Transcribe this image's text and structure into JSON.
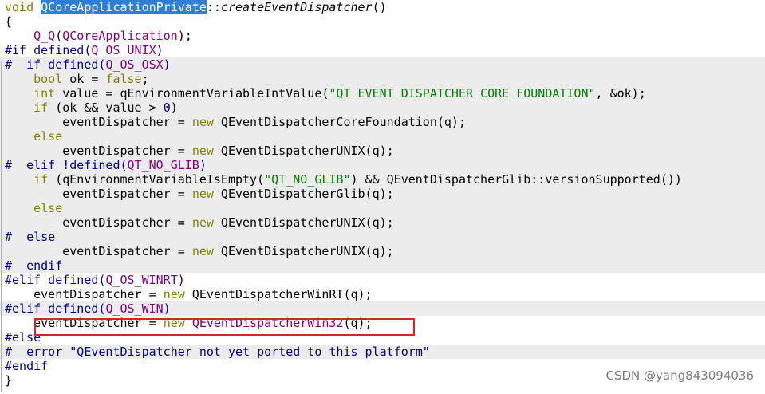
{
  "code_lines": [
    [
      {
        "t": "void",
        "c": "kw"
      },
      {
        "t": " "
      },
      {
        "t": "QCoreApplicationPrivate",
        "c": "sel"
      },
      {
        "t": "::"
      },
      {
        "t": "createEventDispatcher",
        "c": "fn"
      },
      {
        "t": "()"
      }
    ],
    [
      {
        "t": "{"
      }
    ],
    [
      {
        "t": "    "
      },
      {
        "t": "Q_Q",
        "c": "macro"
      },
      {
        "t": "("
      },
      {
        "t": "QCoreApplication",
        "c": "macro"
      },
      {
        "t": ");"
      }
    ],
    [
      {
        "t": "#if defined(",
        "c": "pp"
      },
      {
        "t": "Q_OS_UNIX",
        "c": "macro"
      },
      {
        "t": ")",
        "c": "pp"
      }
    ],
    [
      {
        "t": "#  if defined(",
        "c": "pp"
      },
      {
        "t": "Q_OS_OSX",
        "c": "macro"
      },
      {
        "t": ")",
        "c": "pp"
      }
    ],
    [
      {
        "t": "    "
      },
      {
        "t": "bool",
        "c": "kw"
      },
      {
        "t": " ok = "
      },
      {
        "t": "false",
        "c": "kw"
      },
      {
        "t": ";"
      }
    ],
    [
      {
        "t": "    "
      },
      {
        "t": "int",
        "c": "kw"
      },
      {
        "t": " value = qEnvironmentVariableIntValue("
      },
      {
        "t": "\"QT_EVENT_DISPATCHER_CORE_FOUNDATION\"",
        "c": "str"
      },
      {
        "t": ", &ok);"
      }
    ],
    [
      {
        "t": "    "
      },
      {
        "t": "if",
        "c": "kw"
      },
      {
        "t": " (ok && value > "
      },
      {
        "t": "0",
        "c": "num"
      },
      {
        "t": ")"
      }
    ],
    [
      {
        "t": "        eventDispatcher = "
      },
      {
        "t": "new",
        "c": "kw"
      },
      {
        "t": " QEventDispatcherCoreFoundation(q);"
      }
    ],
    [
      {
        "t": "    "
      },
      {
        "t": "else",
        "c": "kw"
      }
    ],
    [
      {
        "t": "        eventDispatcher = "
      },
      {
        "t": "new",
        "c": "kw"
      },
      {
        "t": " QEventDispatcherUNIX(q);"
      }
    ],
    [
      {
        "t": "#  elif !defined(",
        "c": "pp"
      },
      {
        "t": "QT_NO_GLIB",
        "c": "macro"
      },
      {
        "t": ")",
        "c": "pp"
      }
    ],
    [
      {
        "t": "    "
      },
      {
        "t": "if",
        "c": "kw"
      },
      {
        "t": " (qEnvironmentVariableIsEmpty("
      },
      {
        "t": "\"QT_NO_GLIB\"",
        "c": "str"
      },
      {
        "t": ") && QEventDispatcherGlib::versionSupported())"
      }
    ],
    [
      {
        "t": "        eventDispatcher = "
      },
      {
        "t": "new",
        "c": "kw"
      },
      {
        "t": " QEventDispatcherGlib(q);"
      }
    ],
    [
      {
        "t": "    "
      },
      {
        "t": "else",
        "c": "kw"
      }
    ],
    [
      {
        "t": "        eventDispatcher = "
      },
      {
        "t": "new",
        "c": "kw"
      },
      {
        "t": " QEventDispatcherUNIX(q);"
      }
    ],
    [
      {
        "t": "#  else",
        "c": "pp"
      }
    ],
    [
      {
        "t": "        eventDispatcher = "
      },
      {
        "t": "new",
        "c": "kw"
      },
      {
        "t": " QEventDispatcherUNIX(q);"
      }
    ],
    [
      {
        "t": "#  endif",
        "c": "pp"
      }
    ],
    [
      {
        "t": "#elif defined(",
        "c": "pp"
      },
      {
        "t": "Q_OS_WINRT",
        "c": "macro"
      },
      {
        "t": ")",
        "c": "pp"
      }
    ],
    [
      {
        "t": "    eventDispatcher = "
      },
      {
        "t": "new",
        "c": "kw"
      },
      {
        "t": " QEventDispatcherWinRT(q);"
      }
    ],
    [
      {
        "t": "#elif defined(",
        "c": "pp"
      },
      {
        "t": "Q_OS_WIN",
        "c": "macro"
      },
      {
        "t": ")",
        "c": "pp"
      }
    ],
    [
      {
        "t": "    eventDispatcher = "
      },
      {
        "t": "new",
        "c": "kw"
      },
      {
        "t": " "
      },
      {
        "t": "QEventDispatcherWin32",
        "c": "macro"
      },
      {
        "t": "(q);"
      }
    ],
    [
      {
        "t": "#else",
        "c": "pp"
      }
    ],
    [
      {
        "t": "#  error \"QEventDispatcher not yet ported to this platform\"",
        "c": "pp"
      }
    ],
    [
      {
        "t": "#endif",
        "c": "pp"
      }
    ],
    [
      {
        "t": "}"
      }
    ]
  ],
  "shaded_lines": [
    4,
    5,
    6,
    7,
    8,
    9,
    10,
    11,
    12,
    13,
    14,
    15,
    16,
    17,
    18,
    21,
    24
  ],
  "highlighted_line": 22,
  "colors": {
    "keyword": "#808000",
    "preprocessor": "#000080",
    "macro": "#800080",
    "string": "#008000",
    "selection": "#2f7fd6",
    "highlight_box": "#e0201a"
  },
  "watermark": "CSDN @yang843094036"
}
